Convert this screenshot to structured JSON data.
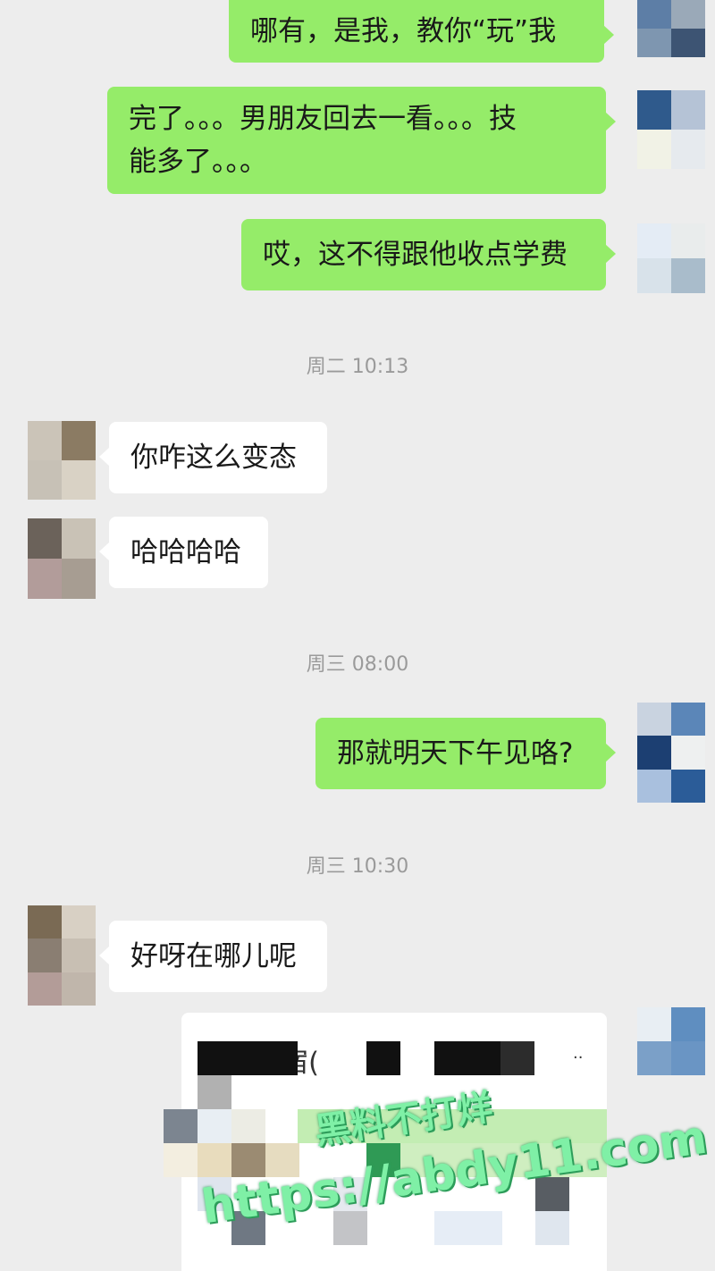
{
  "messages": [
    {
      "id": "m1",
      "side": "out",
      "text": "哪有，是我，教你“玩”我"
    },
    {
      "id": "m2",
      "side": "out",
      "text": "完了。。。男朋友回去一看。。。技\n能多了。。。"
    },
    {
      "id": "m3",
      "side": "out",
      "text": "哎，这不得跟他收点学费"
    },
    {
      "id": "m4",
      "side": "in",
      "text": "你咋这么变态"
    },
    {
      "id": "m5",
      "side": "in",
      "text": "哈哈哈哈"
    },
    {
      "id": "m6",
      "side": "out",
      "text": "那就明天下午见咯?"
    },
    {
      "id": "m7",
      "side": "in",
      "text": "好呀在哪儿呢"
    }
  ],
  "timestamps": [
    "周二 10:13",
    "周三 08:00",
    "周三 10:30"
  ],
  "shared_card": {
    "title_fragment": "民宿("
  },
  "watermark": {
    "line1": "黑料不打烊",
    "line2": "https://abdy11.com"
  },
  "colors": {
    "background": "#ededed",
    "outgoing_bubble": "#95ec69",
    "incoming_bubble": "#ffffff",
    "timestamp": "#9a9a9a",
    "watermark": "#7ff0a6"
  },
  "icons": {
    "avatar_self": "pixelated-avatar",
    "avatar_other": "pixelated-avatar"
  }
}
